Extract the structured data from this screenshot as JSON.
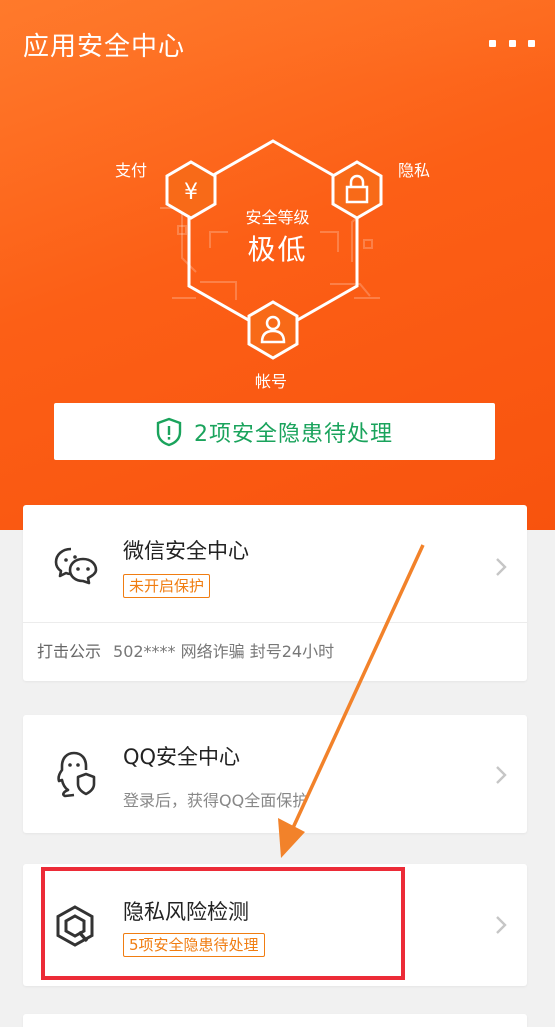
{
  "header": {
    "title": "应用安全中心",
    "more_icon": "more-dots-icon"
  },
  "security": {
    "caption": "安全等级",
    "level": "极低",
    "nodes": {
      "pay": {
        "label": "支付",
        "icon": "yen-icon"
      },
      "privacy": {
        "label": "隐私",
        "icon": "lock-icon"
      },
      "account": {
        "label": "帐号",
        "icon": "user-icon"
      }
    }
  },
  "warning_bar": {
    "text": "2项安全隐患待处理",
    "icon": "shield-alert-icon"
  },
  "cards": {
    "wechat": {
      "name": "微信安全中心",
      "tag": "未开启保护",
      "report_label": "打击公示",
      "report_text": "502**** 网络诈骗  封号24小时",
      "icon": "wechat-icon"
    },
    "qq": {
      "name": "QQ安全中心",
      "sub": "登录后，获得QQ全面保护",
      "icon": "qq-icon"
    },
    "privacy": {
      "name": "隐私风险检测",
      "tag": "5项安全隐患待处理",
      "icon": "privacy-scan-icon"
    }
  },
  "colors": {
    "hero_orange": "#fc5f16",
    "safe_green": "#1aa35c",
    "tag_orange": "#f07d12",
    "highlight_red": "#ec2b37"
  }
}
